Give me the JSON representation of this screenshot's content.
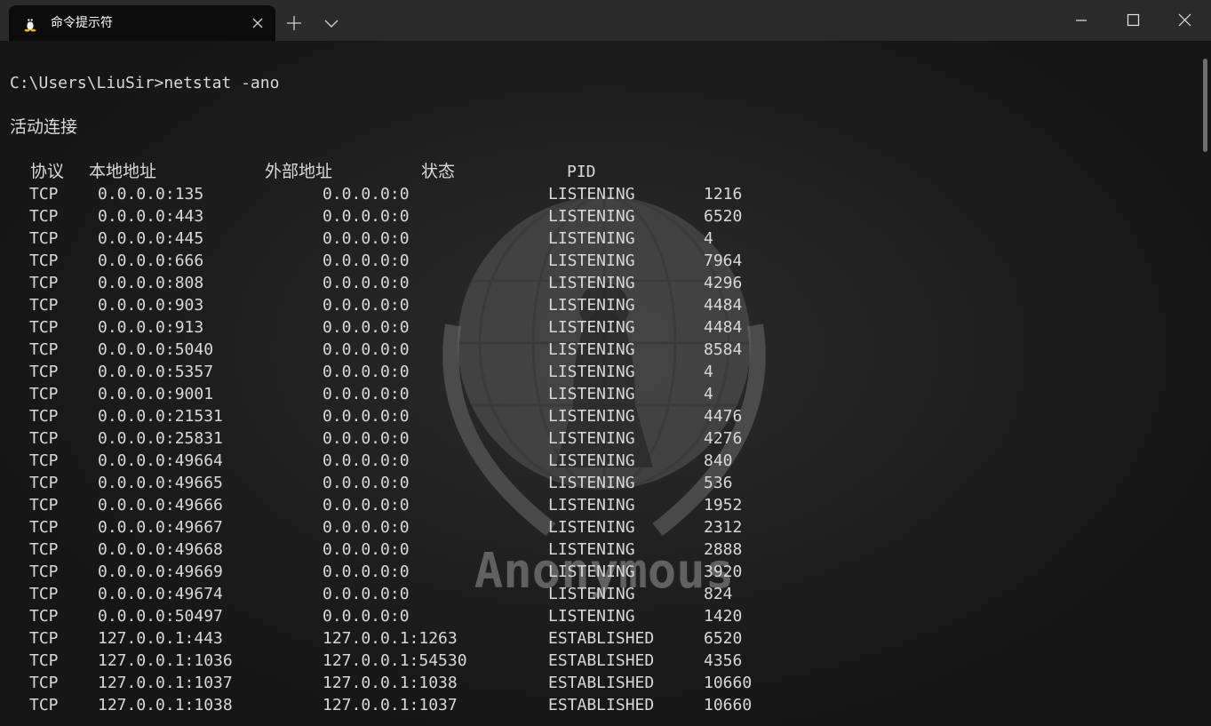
{
  "window": {
    "tab_title": "命令提示符",
    "tab_icon": "linux-penguin-icon",
    "accent": "#0c0c0c"
  },
  "terminal": {
    "prompt": "C:\\Users\\LiuSir>netstat -ano",
    "section_title": "活动连接",
    "watermark_text": "Anonymous",
    "headers": [
      "协议",
      "本地地址",
      "外部地址",
      "状态",
      "PID"
    ],
    "rows": [
      [
        "TCP",
        "0.0.0.0:135",
        "0.0.0.0:0",
        "LISTENING",
        "1216"
      ],
      [
        "TCP",
        "0.0.0.0:443",
        "0.0.0.0:0",
        "LISTENING",
        "6520"
      ],
      [
        "TCP",
        "0.0.0.0:445",
        "0.0.0.0:0",
        "LISTENING",
        "4"
      ],
      [
        "TCP",
        "0.0.0.0:666",
        "0.0.0.0:0",
        "LISTENING",
        "7964"
      ],
      [
        "TCP",
        "0.0.0.0:808",
        "0.0.0.0:0",
        "LISTENING",
        "4296"
      ],
      [
        "TCP",
        "0.0.0.0:903",
        "0.0.0.0:0",
        "LISTENING",
        "4484"
      ],
      [
        "TCP",
        "0.0.0.0:913",
        "0.0.0.0:0",
        "LISTENING",
        "4484"
      ],
      [
        "TCP",
        "0.0.0.0:5040",
        "0.0.0.0:0",
        "LISTENING",
        "8584"
      ],
      [
        "TCP",
        "0.0.0.0:5357",
        "0.0.0.0:0",
        "LISTENING",
        "4"
      ],
      [
        "TCP",
        "0.0.0.0:9001",
        "0.0.0.0:0",
        "LISTENING",
        "4"
      ],
      [
        "TCP",
        "0.0.0.0:21531",
        "0.0.0.0:0",
        "LISTENING",
        "4476"
      ],
      [
        "TCP",
        "0.0.0.0:25831",
        "0.0.0.0:0",
        "LISTENING",
        "4276"
      ],
      [
        "TCP",
        "0.0.0.0:49664",
        "0.0.0.0:0",
        "LISTENING",
        "840"
      ],
      [
        "TCP",
        "0.0.0.0:49665",
        "0.0.0.0:0",
        "LISTENING",
        "536"
      ],
      [
        "TCP",
        "0.0.0.0:49666",
        "0.0.0.0:0",
        "LISTENING",
        "1952"
      ],
      [
        "TCP",
        "0.0.0.0:49667",
        "0.0.0.0:0",
        "LISTENING",
        "2312"
      ],
      [
        "TCP",
        "0.0.0.0:49668",
        "0.0.0.0:0",
        "LISTENING",
        "2888"
      ],
      [
        "TCP",
        "0.0.0.0:49669",
        "0.0.0.0:0",
        "LISTENING",
        "3920"
      ],
      [
        "TCP",
        "0.0.0.0:49674",
        "0.0.0.0:0",
        "LISTENING",
        "824"
      ],
      [
        "TCP",
        "0.0.0.0:50497",
        "0.0.0.0:0",
        "LISTENING",
        "1420"
      ],
      [
        "TCP",
        "127.0.0.1:443",
        "127.0.0.1:1263",
        "ESTABLISHED",
        "6520"
      ],
      [
        "TCP",
        "127.0.0.1:1036",
        "127.0.0.1:54530",
        "ESTABLISHED",
        "4356"
      ],
      [
        "TCP",
        "127.0.0.1:1037",
        "127.0.0.1:1038",
        "ESTABLISHED",
        "10660"
      ],
      [
        "TCP",
        "127.0.0.1:1038",
        "127.0.0.1:1037",
        "ESTABLISHED",
        "10660"
      ]
    ]
  }
}
